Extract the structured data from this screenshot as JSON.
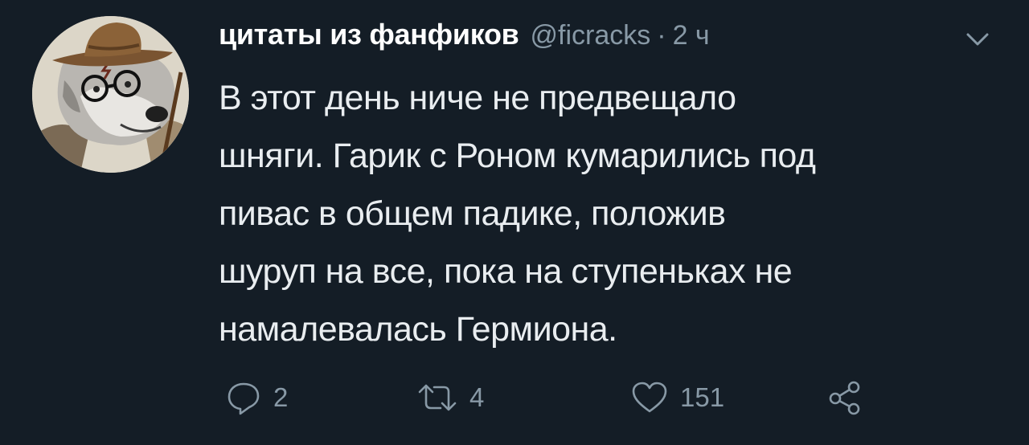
{
  "tweet": {
    "author": {
      "display_name": "цитаты из фанфиков",
      "handle": "@ficracks",
      "separator": "·",
      "time": "2 ч",
      "avatar_icon": "wolf-wizard-avatar"
    },
    "text_lines": [
      "В этот день ниче не предвещало",
      "шняги. Гарик с Роном кумарились под",
      "пивас в общем падике, положив",
      "шуруп на все, пока на ступеньках не",
      "намалевалась Гермиона."
    ],
    "actions": {
      "reply": {
        "icon": "reply-icon",
        "count": "2"
      },
      "retweet": {
        "icon": "retweet-icon",
        "count": "4"
      },
      "like": {
        "icon": "heart-icon",
        "count": "151"
      },
      "share": {
        "icon": "share-icon"
      }
    },
    "menu_icon": "chevron-down-icon"
  },
  "colors": {
    "background": "#141d26",
    "primary_text": "#e9edf0",
    "secondary_text": "#8899a6"
  }
}
